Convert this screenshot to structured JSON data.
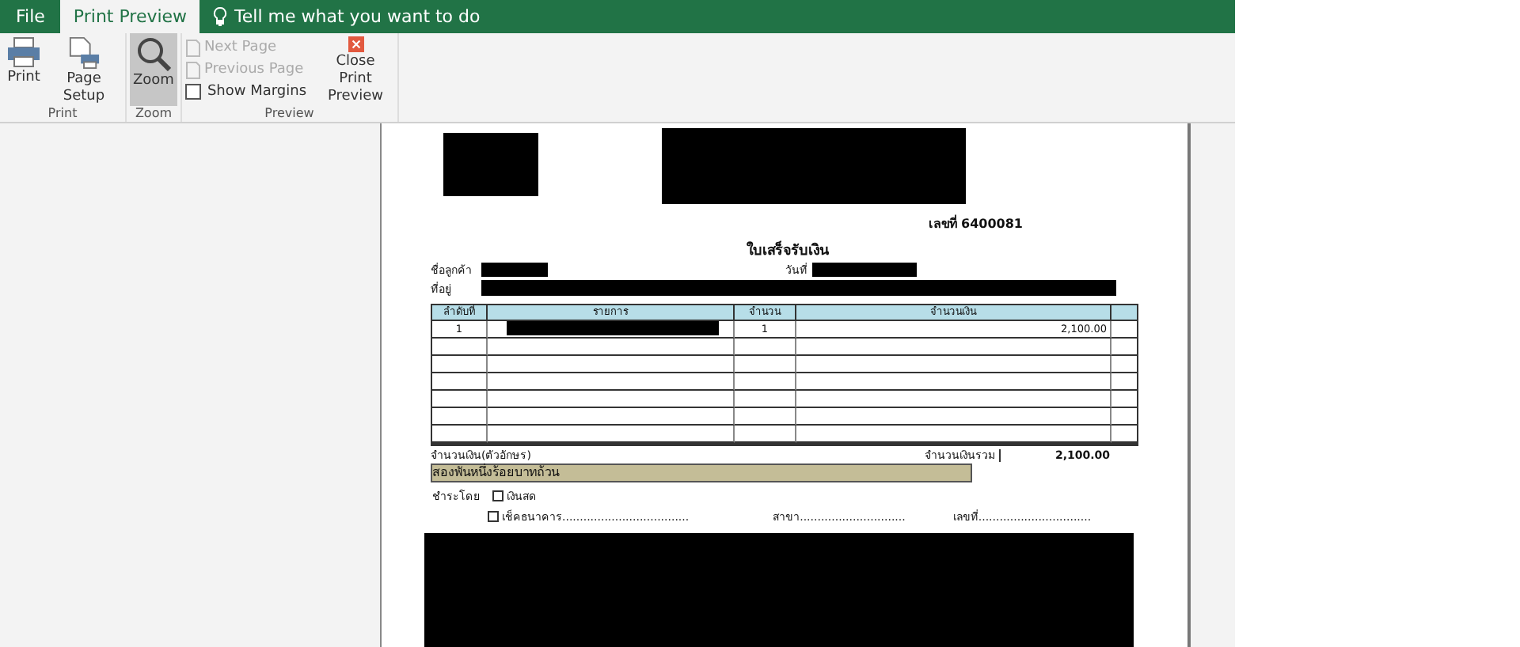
{
  "tabs": [
    {
      "label": "File",
      "selected": false
    },
    {
      "label": "Print Preview",
      "selected": true
    }
  ],
  "tell_me": "Tell me what you want to do",
  "ribbon": {
    "groups": [
      {
        "label": "Print",
        "items": [
          {
            "kind": "large",
            "label": "Print",
            "selected": false
          },
          {
            "kind": "large",
            "label": "Page Setup",
            "selected": false
          }
        ]
      },
      {
        "label": "Zoom",
        "items": [
          {
            "kind": "large",
            "label": "Zoom",
            "selected": true
          }
        ]
      },
      {
        "label": "Preview",
        "items": [
          {
            "kind": "small",
            "label": "Next Page",
            "disabled": true
          },
          {
            "kind": "small",
            "label": "Previous Page",
            "disabled": true
          },
          {
            "kind": "check",
            "label": "Show Margins",
            "checked": false
          },
          {
            "kind": "large",
            "label": "Close Print Preview",
            "selected": false
          }
        ]
      }
    ]
  },
  "doc": {
    "number": "เลขที่ 6400081",
    "title": "ใบเสร็จรับเงิน",
    "customer_label": "ชื่อลูกค้า",
    "date_label": "วันที่",
    "address_label": "ที่อยู่",
    "table": {
      "columns": [
        "ลำดับที่",
        "รายการ",
        "จำนวน",
        "จำนวนเงิน"
      ],
      "rows": [
        {
          "no": "1",
          "item_redacted": true,
          "qty": "1",
          "amount": "2,100.00"
        },
        {},
        {},
        {},
        {},
        {},
        {}
      ]
    },
    "amount_words_label": "จำนวนเงิน(ตัวอักษร)",
    "total_label": "จำนวนเงินรวม",
    "total": "2,100.00",
    "amount_words": "สองพันหนึ่งร้อยบาทถ้วน",
    "paid_by": "ชำระโดย",
    "payment_options": [
      {
        "label": "เงินสด",
        "checked": false
      },
      {
        "label": "เช็คธนาคาร....................................",
        "checked": false
      }
    ],
    "branch": "สาขา..............................",
    "cheque_no": "เลขที่................................"
  }
}
